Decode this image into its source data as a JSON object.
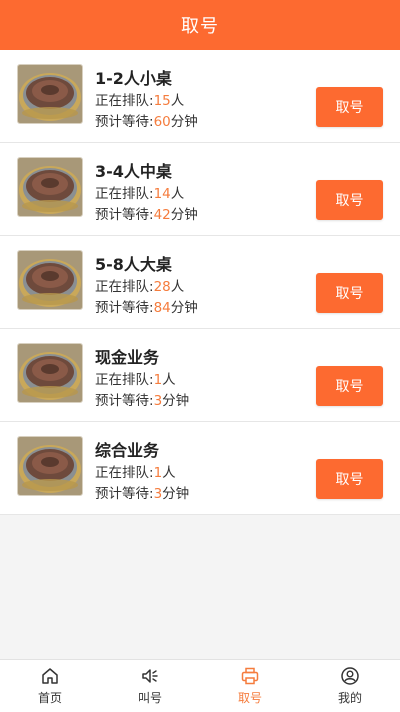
{
  "header": {
    "title": "取号"
  },
  "queues": [
    {
      "name": "1-2人小桌",
      "queue_label": "正在排队:",
      "queue_count": "15",
      "queue_unit": "人",
      "wait_label": "预计等待:",
      "wait_minutes": "60",
      "wait_unit": "分钟",
      "button": "取号",
      "thumb_icon": "grill-food-image"
    },
    {
      "name": "3-4人中桌",
      "queue_label": "正在排队:",
      "queue_count": "14",
      "queue_unit": "人",
      "wait_label": "预计等待:",
      "wait_minutes": "42",
      "wait_unit": "分钟",
      "button": "取号",
      "thumb_icon": "grill-food-image"
    },
    {
      "name": "5-8人大桌",
      "queue_label": "正在排队:",
      "queue_count": "28",
      "queue_unit": "人",
      "wait_label": "预计等待:",
      "wait_minutes": "84",
      "wait_unit": "分钟",
      "button": "取号",
      "thumb_icon": "grill-food-image"
    },
    {
      "name": "现金业务",
      "queue_label": "正在排队:",
      "queue_count": "1",
      "queue_unit": "人",
      "wait_label": "预计等待:",
      "wait_minutes": "3",
      "wait_unit": "分钟",
      "button": "取号",
      "thumb_icon": "grill-food-image"
    },
    {
      "name": "综合业务",
      "queue_label": "正在排队:",
      "queue_count": "1",
      "queue_unit": "人",
      "wait_label": "预计等待:",
      "wait_minutes": "3",
      "wait_unit": "分钟",
      "button": "取号",
      "thumb_icon": "grill-food-image"
    }
  ],
  "tabbar": {
    "active_index": 2,
    "items": [
      {
        "label": "首页",
        "icon": "home-icon"
      },
      {
        "label": "叫号",
        "icon": "speaker-icon"
      },
      {
        "label": "取号",
        "icon": "printer-icon"
      },
      {
        "label": "我的",
        "icon": "user-icon"
      }
    ]
  },
  "colors": {
    "accent": "#fd6a30",
    "number_highlight": "#f57c3d",
    "page_background": "#f4f4f4"
  }
}
